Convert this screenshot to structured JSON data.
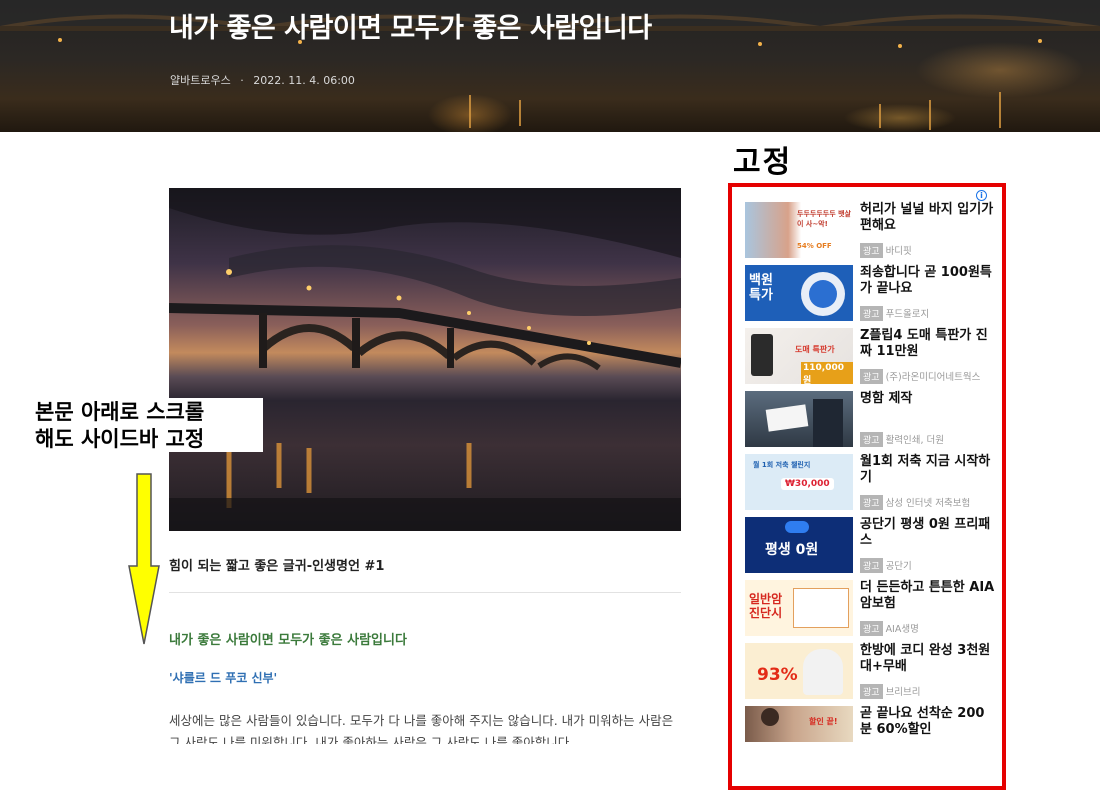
{
  "post": {
    "title": "내가 좋은 사람이면 모두가 좋은 사람입니다",
    "author": "얄바트로우스",
    "separator": "·",
    "date": "2022. 11. 4. 06:00",
    "image_caption": "힘이 되는 짧고 좋은 글귀-인생명언 #1",
    "quote_title": "내가 좋은 사람이면 모두가 좋은 사람입니다",
    "quote_author": "'샤를르 드 푸코 신부'",
    "body": "세상에는 많은 사람들이 있습니다. 모두가 다 나를 좋아해 주지는 않습니다. 내가 미워하는 사람은 그 사람도 나를 미워합니다. 내가 좋아하는 사람은 그 사람도 나를 좋아합니다."
  },
  "annotations": {
    "fixed_label": "고정",
    "scroll_label_line1": "본문 아래로 스크롤",
    "scroll_label_line2": "해도 사이드바 고정"
  },
  "sidebar": {
    "info_icon": "i",
    "badge": "광고",
    "ads": [
      {
        "headline": "허리가 널널 바지 입기가 편해요",
        "source": "바디핏",
        "thumb_text": "두두두두두두 뱃살이 사~악!",
        "thumb_sub": "54% OFF"
      },
      {
        "headline": "죄송합니다 곧 100원특가 끝나요",
        "source": "푸드올로지",
        "thumb_text": "백원 특가"
      },
      {
        "headline": "Z플립4 도매 특판가 진짜 11만원",
        "source": "(주)라온미디어네트웍스",
        "thumb_text": "도매 특판가",
        "thumb_sub": "110,000원"
      },
      {
        "headline": "명함 제작",
        "source": "활력인쇄, 더원"
      },
      {
        "headline": "월1회 저축 지금 시작하기",
        "source": "삼성 인터넷 저축보험",
        "thumb_text": "월 1회 저축 챌린지",
        "thumb_sub": "₩30,000"
      },
      {
        "headline": "공단기 평생 0원 프리패스",
        "source": "공단기",
        "thumb_text": "평생 0원"
      },
      {
        "headline": "더 든든하고 튼튼한 AIA 암보험",
        "source": "AIA생명",
        "thumb_text": "일반암 진단시"
      },
      {
        "headline": "한방에 코디 완성 3천원대+무배",
        "source": "브리브리",
        "thumb_text": "93%"
      },
      {
        "headline": "곧 끝나요 선착순 200분 60%할인",
        "source": "",
        "thumb_text": "할인 끝!"
      }
    ]
  }
}
